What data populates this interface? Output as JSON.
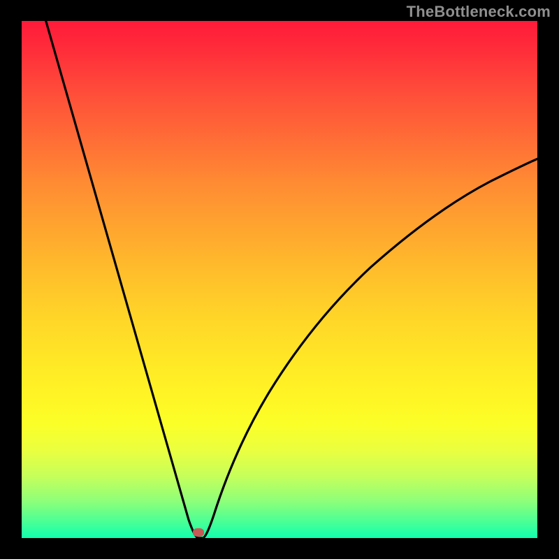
{
  "watermark": "TheBottleneck.com",
  "chart_data": {
    "type": "line",
    "title": "",
    "xlabel": "",
    "ylabel": "",
    "xlim": [
      0,
      100
    ],
    "ylim": [
      0,
      100
    ],
    "grid": false,
    "legend": false,
    "background_gradient": {
      "top_color": "#ff1a3a",
      "bottom_color": "#10ffad",
      "description": "red-to-green vertical gradient (high = bad, low/green = good)"
    },
    "series": [
      {
        "name": "bottleneck-curve",
        "color": "#000000",
        "x": [
          0,
          5,
          10,
          15,
          20,
          25,
          30,
          33,
          34,
          35,
          36,
          38,
          40,
          45,
          50,
          55,
          60,
          65,
          70,
          75,
          80,
          85,
          90,
          95,
          100
        ],
        "y": [
          100,
          85,
          70,
          55,
          40,
          25,
          10,
          2,
          0,
          0,
          2,
          7,
          14,
          27,
          37,
          45,
          52,
          57,
          62,
          66,
          69,
          72,
          74,
          76,
          77
        ]
      }
    ],
    "marker": {
      "name": "optimal-point",
      "x": 34,
      "y": 0,
      "color": "#c65a56"
    },
    "notes": "Values estimated from pixel positions; axes unlabeled in source image. y=0 is bottom (green/optimal), y=100 is top (red)."
  }
}
